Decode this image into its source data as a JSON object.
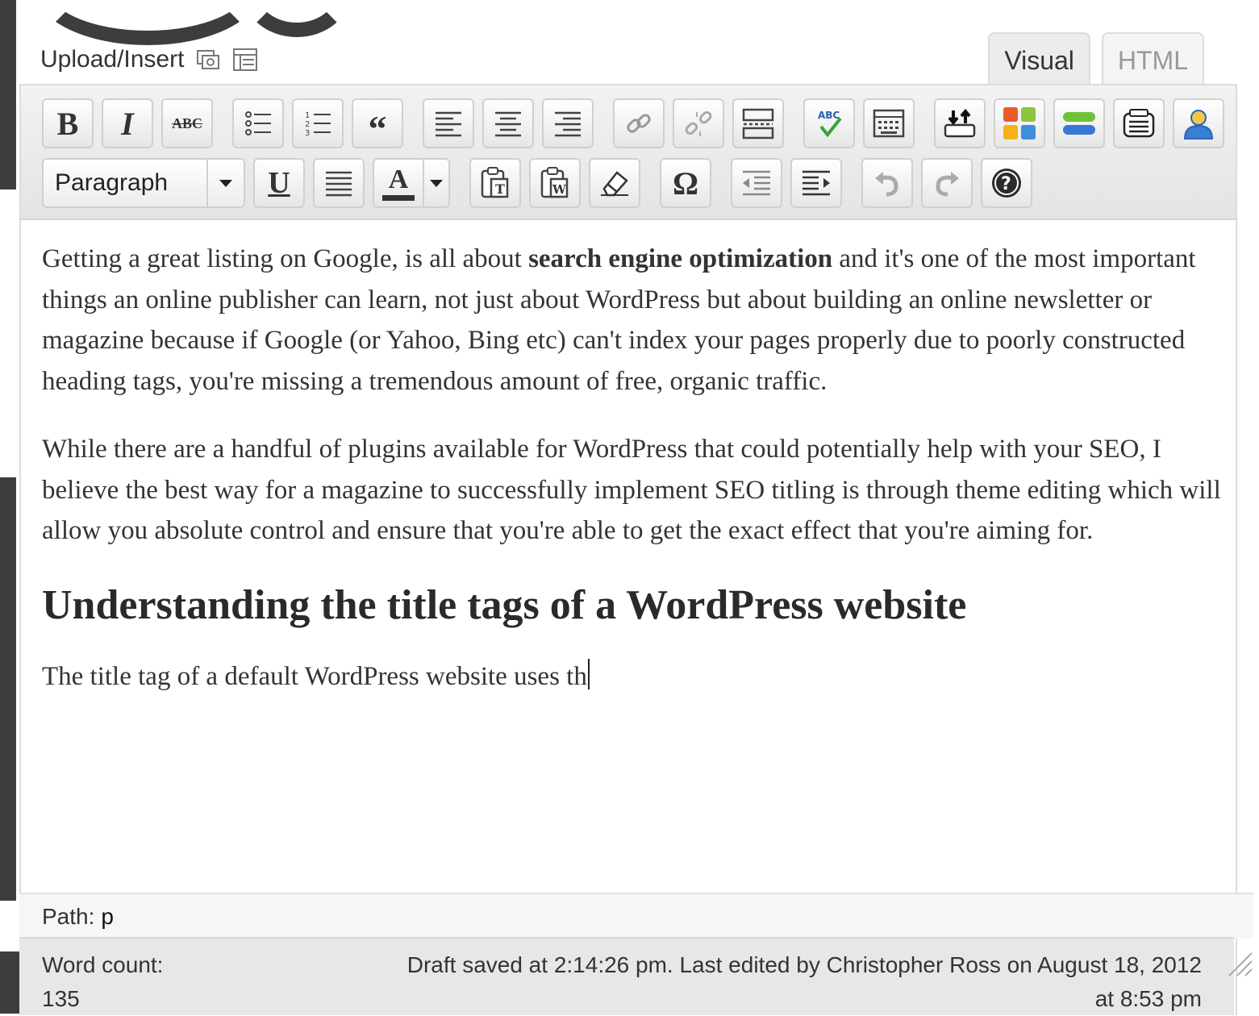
{
  "media": {
    "label": "Upload/Insert",
    "icons": [
      "add-media-icon",
      "add-gallery-icon"
    ]
  },
  "tabs": {
    "visual": "Visual",
    "html": "HTML",
    "active": "Visual"
  },
  "toolbar": {
    "row1": [
      "bold",
      "italic",
      "strikethrough",
      "bullet-list",
      "numbered-list",
      "blockquote",
      "align-left",
      "align-center",
      "align-right",
      "insert-link",
      "unlink",
      "insert-more",
      "spellcheck",
      "kitchen-sink",
      "plugin-1",
      "plugin-2",
      "plugin-3",
      "plugin-4",
      "plugin-5"
    ],
    "format_select": "Paragraph",
    "bold_glyph": "B",
    "italic_glyph": "I",
    "strike_glyph": "ABC",
    "quote_glyph": "66",
    "underline_glyph": "U",
    "color_glyph": "A",
    "omega_glyph": "Ω"
  },
  "content": {
    "p1_before": "Getting a great listing on Google, is all about ",
    "p1_bold": "search engine optimization",
    "p1_after": " and it's one of the most important things an online publisher can learn, not just about WordPress but about building an online newsletter or magazine because if Google (or Yahoo, Bing etc) can't index your pages properly due to poorly constructed heading tags, you're missing a tremendous amount of free, organic traffic.",
    "p2": "While there are a handful of plugins available for WordPress that could potentially help with your SEO, I believe the best way for a magazine to successfully implement SEO titling is through theme editing which will allow you absolute control and ensure that you're able to get the exact effect that you're aiming for.",
    "heading": "Understanding the title tags of a WordPress website",
    "p3": "The title tag of a default WordPress website uses th"
  },
  "path": {
    "label": "Path:",
    "value": "p"
  },
  "status": {
    "word_count_label": "Word count:",
    "word_count": "135",
    "draft_line1": "Draft saved at 2:14:26 pm. Last edited by Christopher Ross on August 18, 2012",
    "draft_line2": "at 8:53 pm"
  },
  "colors": {
    "toolbar": "#e9e9e9",
    "text": "#333333",
    "status": "#e7e7e7",
    "background_shape": "#3e3d3b"
  }
}
